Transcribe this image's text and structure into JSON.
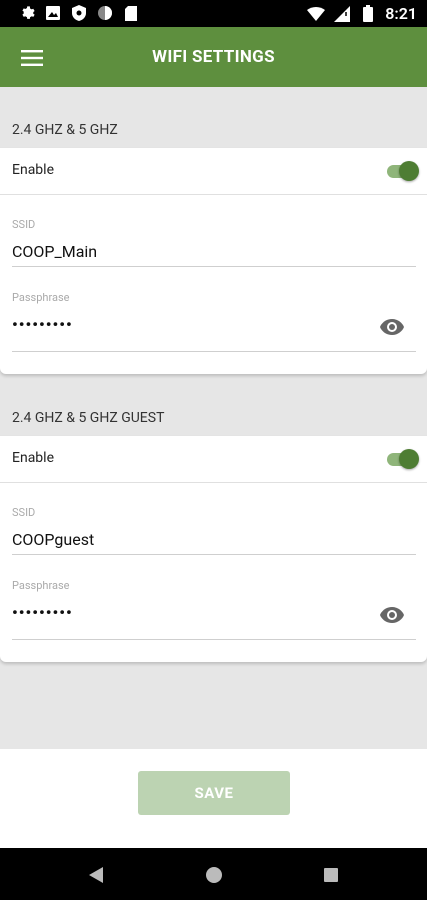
{
  "status_bar": {
    "time": "8:21",
    "icons_left": [
      "settings-icon",
      "photo-icon",
      "shield-icon",
      "circle-icon",
      "sd-card-icon"
    ],
    "icons_right": [
      "wifi-icon",
      "signal-icon",
      "battery-icon"
    ]
  },
  "app_bar": {
    "title": "WIFI SETTINGS",
    "menu_icon": "hamburger-menu-icon",
    "color": "#5e8f3e"
  },
  "networks": [
    {
      "section_label": "2.4 GHZ & 5 GHZ",
      "enable_label": "Enable",
      "enabled": true,
      "ssid_label": "SSID",
      "ssid_value": "COOP_Main",
      "passphrase_label": "Passphrase",
      "passphrase_value": "•••••••••"
    },
    {
      "section_label": "2.4 GHZ & 5 GHZ GUEST",
      "enable_label": "Enable",
      "enabled": true,
      "ssid_label": "SSID",
      "ssid_value": "COOPguest",
      "passphrase_label": "Passphrase",
      "passphrase_value": "•••••••••"
    }
  ],
  "footer": {
    "save_label": "SAVE",
    "save_color": "#bcd3b2"
  },
  "nav_bar": {
    "buttons": [
      "back-icon",
      "home-icon",
      "recents-icon"
    ]
  }
}
